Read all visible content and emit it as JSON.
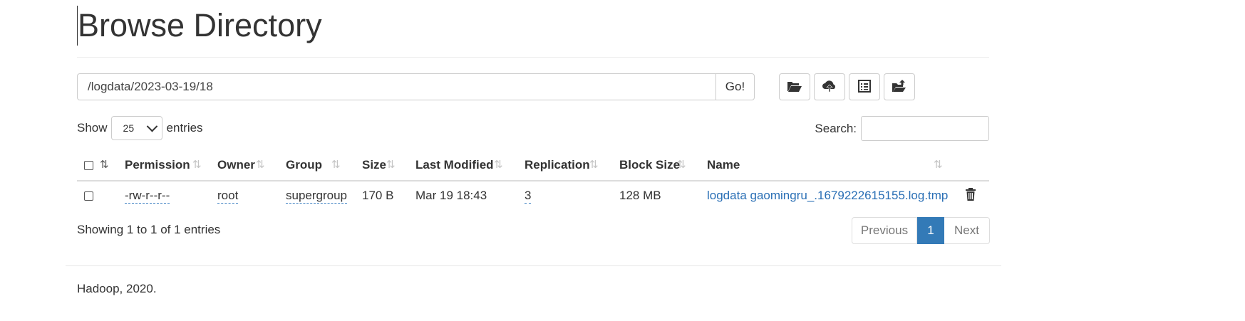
{
  "page": {
    "title": "Browse Directory"
  },
  "path_bar": {
    "value": "/logdata/2023-03-19/18",
    "go_label": "Go!"
  },
  "toolbar": {
    "buttons": [
      {
        "icon": "folder-open-icon"
      },
      {
        "icon": "cloud-upload-icon"
      },
      {
        "icon": "list-alt-icon"
      },
      {
        "icon": "folder-upload-icon"
      }
    ]
  },
  "entries": {
    "show_label": "Show",
    "selected": "25",
    "suffix_label": "entries"
  },
  "search": {
    "label": "Search:",
    "value": ""
  },
  "table": {
    "headers": [
      "Permission",
      "Owner",
      "Group",
      "Size",
      "Last Modified",
      "Replication",
      "Block Size",
      "Name"
    ],
    "rows": [
      {
        "permission": "-rw-r--r--",
        "owner": "root",
        "group": "supergroup",
        "size": "170 B",
        "last_modified": "Mar 19 18:43",
        "replication": "3",
        "block_size": "128 MB",
        "name": "logdata gaomingru_.1679222615155.log.tmp"
      }
    ]
  },
  "info": {
    "text": "Showing 1 to 1 of 1 entries"
  },
  "pagination": {
    "previous": "Previous",
    "current": "1",
    "next": "Next"
  },
  "footer": {
    "text": "Hadoop, 2020."
  },
  "colors": {
    "accent": "#337ab7",
    "link": "#2a6fb5"
  }
}
